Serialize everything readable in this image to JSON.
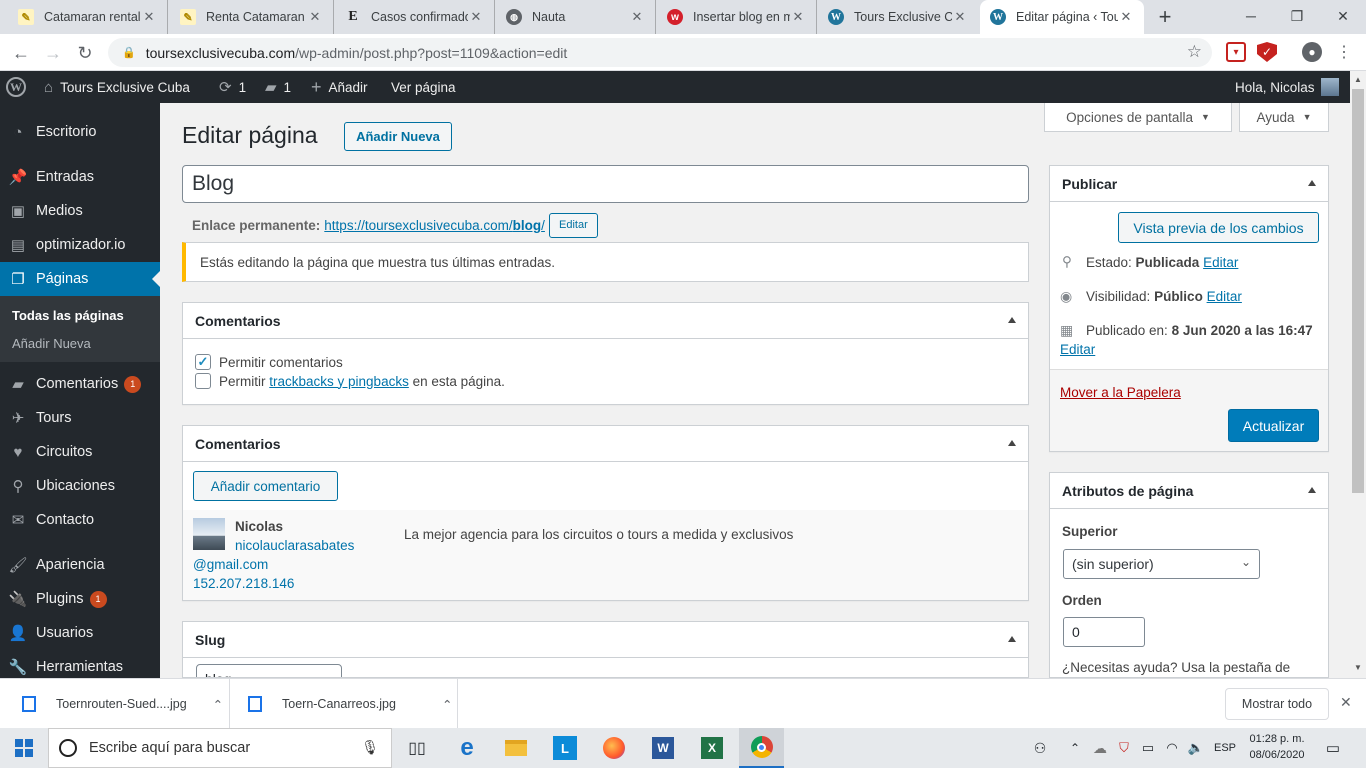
{
  "browser": {
    "tabs": [
      {
        "title": "Catamaran rental",
        "icon": "document-icon"
      },
      {
        "title": "Renta Catamaran",
        "icon": "document-icon"
      },
      {
        "title": "Casos confirmados",
        "icon": "e-icon"
      },
      {
        "title": "Nauta",
        "icon": "globe-icon"
      },
      {
        "title": "Insertar blog en m",
        "icon": "red-w-icon"
      },
      {
        "title": "Tours Exclusive Cu",
        "icon": "wordpress-icon"
      },
      {
        "title": "Editar página ‹ Tou",
        "icon": "wordpress-icon"
      }
    ],
    "new_tab": "+",
    "url_host": "toursexclusivecuba.com",
    "url_path": "/wp-admin/post.php?post=1109&action=edit"
  },
  "adminbar": {
    "site_name": "Tours Exclusive Cuba",
    "updates_count": "1",
    "comments_count": "1",
    "add_label": "Añadir",
    "view_label": "Ver página",
    "greeting": "Hola, Nicolas"
  },
  "sidebar": {
    "items": [
      {
        "label": "Escritorio",
        "icon": "dashboard-icon"
      },
      {
        "label": "Entradas",
        "icon": "pin-icon"
      },
      {
        "label": "Medios",
        "icon": "media-icon"
      },
      {
        "label": "optimizador.io",
        "icon": "optimizer-icon"
      },
      {
        "label": "Páginas",
        "icon": "pages-icon"
      },
      {
        "label": "Comentarios",
        "icon": "comment-icon",
        "badge": "1"
      },
      {
        "label": "Tours",
        "icon": "plane-icon"
      },
      {
        "label": "Circuitos",
        "icon": "heart-icon"
      },
      {
        "label": "Ubicaciones",
        "icon": "location-icon"
      },
      {
        "label": "Contacto",
        "icon": "mail-icon"
      },
      {
        "label": "Apariencia",
        "icon": "brush-icon"
      },
      {
        "label": "Plugins",
        "icon": "plugin-icon",
        "badge": "1"
      },
      {
        "label": "Usuarios",
        "icon": "user-icon"
      },
      {
        "label": "Herramientas",
        "icon": "wrench-icon"
      }
    ],
    "submenu": [
      "Todas las páginas",
      "Añadir Nueva"
    ]
  },
  "screen_options": "Opciones de pantalla",
  "help": "Ayuda",
  "page": {
    "heading": "Editar página",
    "add_new": "Añadir Nueva",
    "title_value": "Blog",
    "permalink_label": "Enlace permanente:",
    "permalink_base": "https://toursexclusivecuba.com/",
    "permalink_slug": "blog",
    "permalink_end": "/",
    "permalink_edit": "Editar",
    "notice": "Estás editando la página que muestra tus últimas entradas."
  },
  "discussion_box": {
    "title": "Comentarios",
    "allow_comments": "Permitir comentarios",
    "allow_pre": "Permitir",
    "trackbacks_link": "trackbacks y pingbacks",
    "allow_post": "en esta página."
  },
  "comments_box": {
    "title": "Comentarios",
    "add_button": "Añadir comentario",
    "comment": {
      "author": "Nicolas",
      "email_line1": "nicolauclarasabates",
      "email_line2": "@gmail.com",
      "ip": "152.207.218.146",
      "text": "La mejor agencia para los circuitos o tours a medida y exclusivos"
    }
  },
  "slug_box": {
    "title": "Slug",
    "value": "blog"
  },
  "publish_box": {
    "title": "Publicar",
    "preview": "Vista previa de los cambios",
    "status_label": "Estado:",
    "status_value": "Publicada",
    "visibility_label": "Visibilidad:",
    "visibility_value": "Público",
    "published_label": "Publicado en:",
    "published_value": "8 Jun 2020 a las 16:47",
    "edit": "Editar",
    "trash": "Mover a la Papelera",
    "update": "Actualizar"
  },
  "attributes_box": {
    "title": "Atributos de página",
    "parent_label": "Superior",
    "parent_value": "(sin superior)",
    "order_label": "Orden",
    "order_value": "0",
    "help": "¿Necesitas ayuda? Usa la pestaña de"
  },
  "downloads": {
    "files": [
      "Toernrouten-Sued....jpg",
      "Toern-Canarreos.jpg"
    ],
    "show_all": "Mostrar todo"
  },
  "taskbar": {
    "search_placeholder": "Escribe aquí para buscar",
    "lang": "ESP",
    "time": "01:28 p. m.",
    "date": "08/06/2020"
  },
  "colors": {
    "wp_blue": "#0073aa",
    "admin_dark": "#23282d",
    "badge": "#ca4a1f",
    "notice": "#ffb900",
    "trash": "#a00"
  }
}
